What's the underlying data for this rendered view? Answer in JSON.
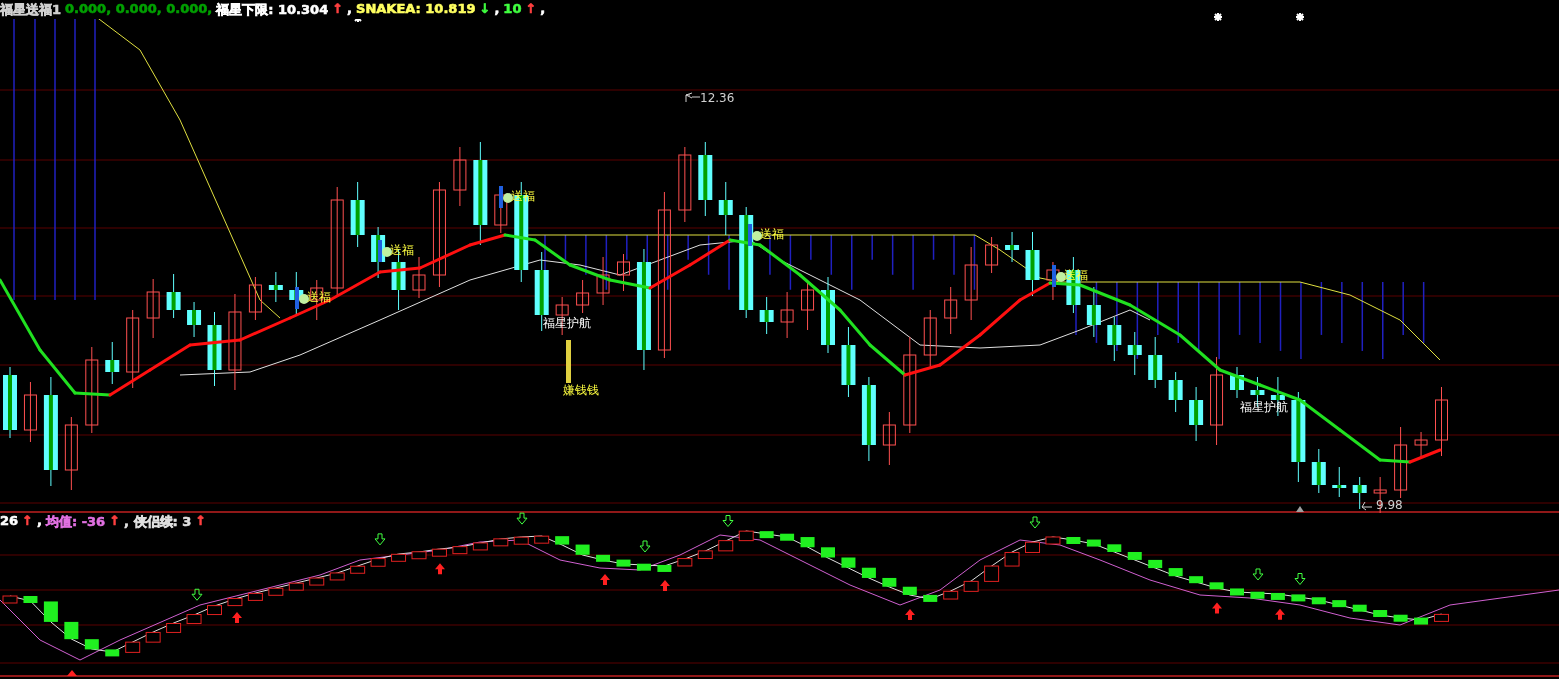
{
  "main_panel": {
    "legend": [
      {
        "text": "福星送福1",
        "color": "#d0d0d0"
      },
      {
        "text": "0.000, 0.000, 0.000,",
        "color": "#00a000"
      },
      {
        "text": "福星下限: 10.304",
        "color": "#ffffff"
      },
      {
        "text": "↑",
        "color": "#ff4040"
      },
      {
        "text": ",",
        "color": "#ffffff"
      },
      {
        "text": "SNAKEA: 10.819",
        "color": "#ffff60"
      },
      {
        "text": "↓",
        "color": "#40ff40"
      },
      {
        "text": ",",
        "color": "#ffffff"
      },
      {
        "text": "10",
        "color": "#40ff40"
      },
      {
        "text": "↑",
        "color": "#ff4040"
      },
      {
        "text": ",",
        "color": "#ffffff"
      }
    ],
    "labels": [
      {
        "kind": "signal",
        "text": "送福"
      },
      {
        "kind": "signal",
        "text": "送福"
      },
      {
        "kind": "signal",
        "text": "送福"
      },
      {
        "kind": "signal",
        "text": "送福"
      },
      {
        "kind": "signal",
        "text": "送福"
      },
      {
        "kind": "escort",
        "text": "福星护航"
      },
      {
        "kind": "escort",
        "text": "福星护航"
      },
      {
        "kind": "money",
        "text": "嫌钱钱"
      },
      {
        "kind": "high",
        "text": "12.36"
      },
      {
        "kind": "low",
        "text": "9.98"
      }
    ]
  },
  "sub_panel": {
    "legend": [
      {
        "text": "26",
        "color": "#ffffff"
      },
      {
        "text": "↑",
        "color": "#ff4040"
      },
      {
        "text": ",",
        "color": "#ffffff"
      },
      {
        "text": "均值: -36",
        "color": "#e070e0"
      },
      {
        "text": "↑",
        "color": "#ff4040"
      },
      {
        "text": ", 侠侣续: 3",
        "color": "#e0e0e0"
      },
      {
        "text": "↑",
        "color": "#ff4040"
      }
    ]
  }
}
